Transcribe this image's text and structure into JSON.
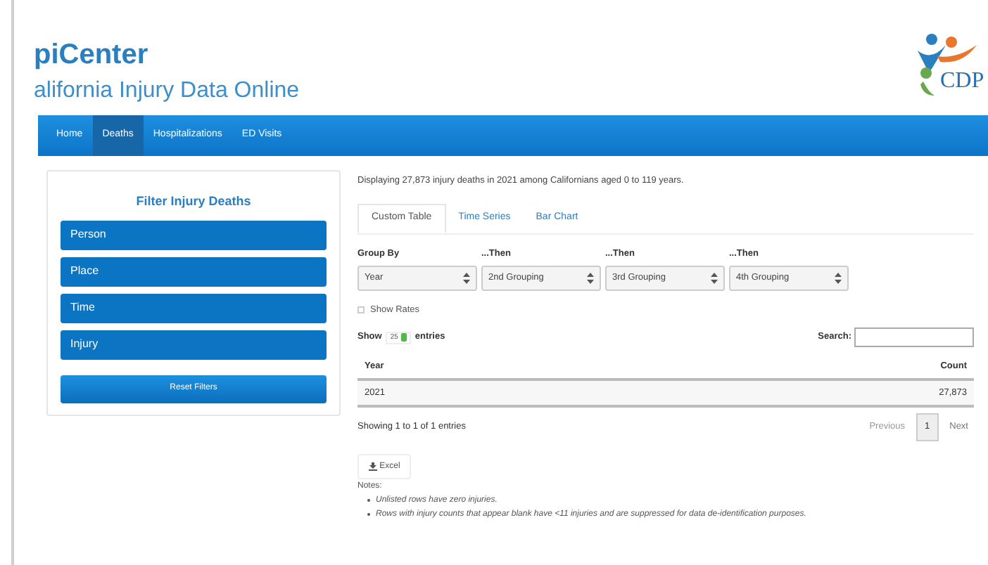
{
  "header": {
    "title": "piCenter",
    "subtitle": "alifornia Injury Data Online",
    "logo_text": "CDP"
  },
  "nav": [
    {
      "label": "Home",
      "selected": false
    },
    {
      "label": "Deaths",
      "selected": true
    },
    {
      "label": "Hospitalizations",
      "selected": false
    },
    {
      "label": "ED Visits",
      "selected": false
    }
  ],
  "filter_panel": {
    "title": "Filter Injury Deaths",
    "items": [
      "Person",
      "Place",
      "Time",
      "Injury"
    ],
    "reset_button": "Reset Filters"
  },
  "summary": "Displaying 27,873 injury deaths in 2021 among Californians aged 0 to 119 years.",
  "tabs": [
    {
      "label": "Custom Table",
      "selected": true
    },
    {
      "label": "Time Series",
      "selected": false
    },
    {
      "label": "Bar Chart",
      "selected": false
    }
  ],
  "groupings": [
    {
      "label": "Group By",
      "value": "Year"
    },
    {
      "label": "...Then",
      "value": "2nd Grouping"
    },
    {
      "label": "...Then",
      "value": "3rd Grouping"
    },
    {
      "label": "...Then",
      "value": "4th Grouping"
    }
  ],
  "show_rates": {
    "label": "Show Rates",
    "checked": false
  },
  "entries": {
    "prefix": "Show",
    "value": "25",
    "suffix": "entries"
  },
  "search": {
    "label": "Search:"
  },
  "table": {
    "columns": [
      "Year",
      "Count"
    ],
    "rows": [
      [
        "2021",
        "27,873"
      ]
    ]
  },
  "table_info": "Showing 1 to 1 of 1 entries",
  "pagination": {
    "previous": "Previous",
    "pages": [
      {
        "label": "1",
        "selected": true
      }
    ],
    "next": "Next"
  },
  "excel_button": "Excel",
  "notes": {
    "title": "Notes:",
    "items": [
      "Unlisted rows have zero injuries.",
      "Rows with injury counts that appear blank have <11 injuries and are suppressed for data de-identification purposes."
    ]
  }
}
